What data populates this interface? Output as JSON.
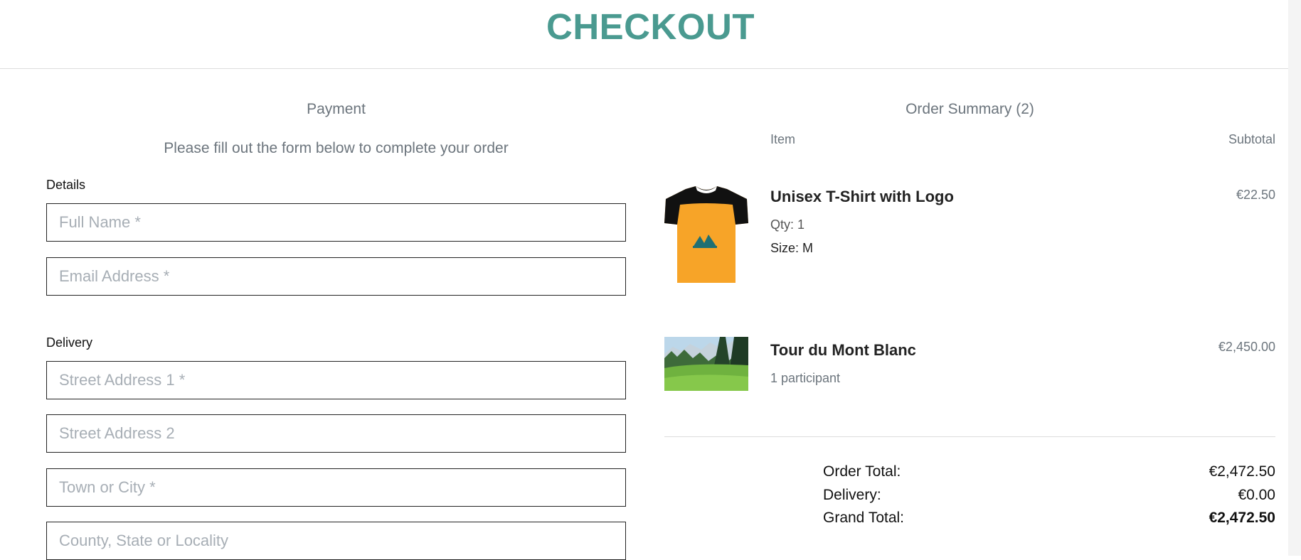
{
  "header": {
    "title": "CHECKOUT"
  },
  "payment": {
    "heading": "Payment",
    "subheading": "Please fill out the form below to complete your order",
    "details_label": "Details",
    "delivery_label": "Delivery",
    "fields": {
      "full_name": {
        "placeholder": "Full Name *",
        "value": ""
      },
      "email": {
        "placeholder": "Email Address *",
        "value": ""
      },
      "street1": {
        "placeholder": "Street Address 1 *",
        "value": ""
      },
      "street2": {
        "placeholder": "Street Address 2",
        "value": ""
      },
      "town": {
        "placeholder": "Town or City *",
        "value": ""
      },
      "county": {
        "placeholder": "County, State or Locality",
        "value": ""
      }
    }
  },
  "summary": {
    "heading": "Order Summary (2)",
    "col_item": "Item",
    "col_subtotal": "Subtotal",
    "items": [
      {
        "name": "Unisex T-Shirt with Logo",
        "qty": "Qty: 1",
        "size": "Size: M",
        "price": "€22.50",
        "image_icon": "t-shirt-product-image"
      },
      {
        "name": "Tour du Mont Blanc",
        "detail": "1 participant",
        "price": "€2,450.00",
        "image_icon": "mountain-meadow-product-image"
      }
    ],
    "totals": {
      "order_total_label": "Order Total:",
      "order_total": "€2,472.50",
      "delivery_label": "Delivery:",
      "delivery": "€0.00",
      "grand_total_label": "Grand Total:",
      "grand_total": "€2,472.50"
    }
  },
  "colors": {
    "accent": "#4a9a90",
    "muted": "#6c757d",
    "border": "#222222"
  }
}
